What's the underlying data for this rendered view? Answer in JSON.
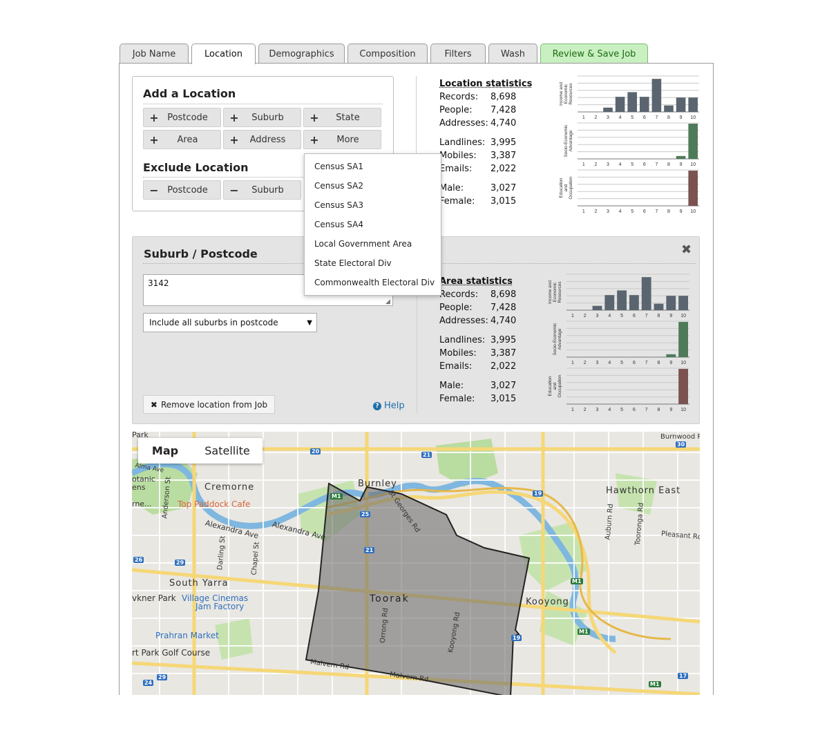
{
  "tabs": [
    {
      "label": "Job Name"
    },
    {
      "label": "Location"
    },
    {
      "label": "Demographics"
    },
    {
      "label": "Composition"
    },
    {
      "label": "Filters"
    },
    {
      "label": "Wash"
    },
    {
      "label": "Review & Save Job"
    }
  ],
  "add_location": {
    "title": "Add a Location",
    "buttons": [
      "Postcode",
      "Suburb",
      "State",
      "Area",
      "Address",
      "More"
    ],
    "exclude_title": "Exclude Location",
    "exclude_buttons": [
      "Postcode",
      "Suburb"
    ]
  },
  "more_menu": [
    "Census SA1",
    "Census SA2",
    "Census SA3",
    "Census SA4",
    "Local Government Area",
    "State Electoral Div",
    "Commonwealth Electoral Div"
  ],
  "location_stats": {
    "title": "Location statistics",
    "rows": [
      {
        "label": "Records:",
        "value": "8,698"
      },
      {
        "label": "People:",
        "value": "7,428"
      },
      {
        "label": "Addresses:",
        "value": "4,740"
      },
      {
        "label": "Landlines:",
        "value": "3,995"
      },
      {
        "label": "Mobiles:",
        "value": "3,387"
      },
      {
        "label": "Emails:",
        "value": "2,022"
      },
      {
        "label": "Male:",
        "value": "3,027"
      },
      {
        "label": "Female:",
        "value": "3,015"
      }
    ]
  },
  "area_stats": {
    "title": "Area statistics",
    "rows": [
      {
        "label": "Records:",
        "value": "8,698"
      },
      {
        "label": "People:",
        "value": "7,428"
      },
      {
        "label": "Addresses:",
        "value": "4,740"
      },
      {
        "label": "Landlines:",
        "value": "3,995"
      },
      {
        "label": "Mobiles:",
        "value": "3,387"
      },
      {
        "label": "Emails:",
        "value": "2,022"
      },
      {
        "label": "Male:",
        "value": "3,027"
      },
      {
        "label": "Female:",
        "value": "3,015"
      }
    ]
  },
  "chart_data": [
    {
      "type": "bar",
      "ylabel": "Income and Economic Resources",
      "categories": [
        "1",
        "2",
        "3",
        "4",
        "5",
        "6",
        "7",
        "8",
        "9",
        "10"
      ],
      "values": [
        0,
        0,
        1.2,
        4.2,
        5.5,
        4.2,
        9.2,
        1.8,
        4.0,
        4.0
      ],
      "ylim": [
        0,
        10
      ],
      "color": "#5a6570"
    },
    {
      "type": "bar",
      "ylabel": "Socio-Economic Advantage",
      "categories": [
        "1",
        "2",
        "3",
        "4",
        "5",
        "6",
        "7",
        "8",
        "9",
        "10"
      ],
      "values": [
        0,
        0,
        0,
        0,
        0,
        0,
        0,
        0,
        0.8,
        9.8
      ],
      "ylim": [
        0,
        10
      ],
      "color": "#4e7a5a"
    },
    {
      "type": "bar",
      "ylabel": "Education and Occupation",
      "categories": [
        "1",
        "2",
        "3",
        "4",
        "5",
        "6",
        "7",
        "8",
        "9",
        "10"
      ],
      "values": [
        0,
        0,
        0,
        0,
        0,
        0,
        0,
        0,
        0,
        9.8
      ],
      "ylim": [
        0,
        10
      ],
      "color": "#7a5250"
    },
    {
      "type": "bar",
      "ylabel": "Income and Economic Resources",
      "categories": [
        "1",
        "2",
        "3",
        "4",
        "5",
        "6",
        "7",
        "8",
        "9",
        "10"
      ],
      "values": [
        0,
        0,
        1.2,
        4.2,
        5.5,
        4.2,
        9.2,
        1.8,
        4.0,
        4.0
      ],
      "ylim": [
        0,
        10
      ],
      "color": "#5a6570"
    },
    {
      "type": "bar",
      "ylabel": "Socio-Economic Advantage",
      "categories": [
        "1",
        "2",
        "3",
        "4",
        "5",
        "6",
        "7",
        "8",
        "9",
        "10"
      ],
      "values": [
        0,
        0,
        0,
        0,
        0,
        0,
        0,
        0,
        0.8,
        9.8
      ],
      "ylim": [
        0,
        10
      ],
      "color": "#4e7a5a"
    },
    {
      "type": "bar",
      "ylabel": "Education and Occupation",
      "categories": [
        "1",
        "2",
        "3",
        "4",
        "5",
        "6",
        "7",
        "8",
        "9",
        "10"
      ],
      "values": [
        0,
        0,
        0,
        0,
        0,
        0,
        0,
        0,
        0,
        9.8
      ],
      "ylim": [
        0,
        10
      ],
      "color": "#7a5250"
    }
  ],
  "suburb_panel": {
    "title": "Suburb / Postcode",
    "close_icon": "close-icon",
    "input_value": "3142",
    "select_value": "Include all suburbs in postcode",
    "remove_label": "Remove location from Job",
    "help_label": "Help"
  },
  "map": {
    "map_tab": "Map",
    "satellite_tab": "Satellite",
    "labels": [
      "Burnley",
      "Cremorne",
      "Top Paddock Cafe",
      "Alexandra Ave",
      "Alexandra Ave",
      "South Yarra",
      "Village Cinemas",
      "Jam Factory",
      "Prahran Market",
      "Toorak",
      "Kooyong",
      "Hawthorn East",
      "Burnwood Rd",
      "Pleasant Rd",
      "St Georges Rd",
      "Orrong Rd",
      "Kooyong Rd",
      "Malvern Rd",
      "Malvern Rd",
      "Anderson St",
      "Darling St",
      "Chapel St",
      "Auburn Rd",
      "Tooronga Rd",
      "rt Park Golf Course",
      "vkner Park",
      "otanic",
      "ens",
      "rne...",
      "Park",
      "Alma Ave"
    ],
    "shields": [
      "20",
      "21",
      "25",
      "21",
      "M1",
      "26",
      "29",
      "19",
      "19",
      "M1",
      "M1",
      "30",
      "17",
      "M1",
      "24",
      "29"
    ]
  }
}
